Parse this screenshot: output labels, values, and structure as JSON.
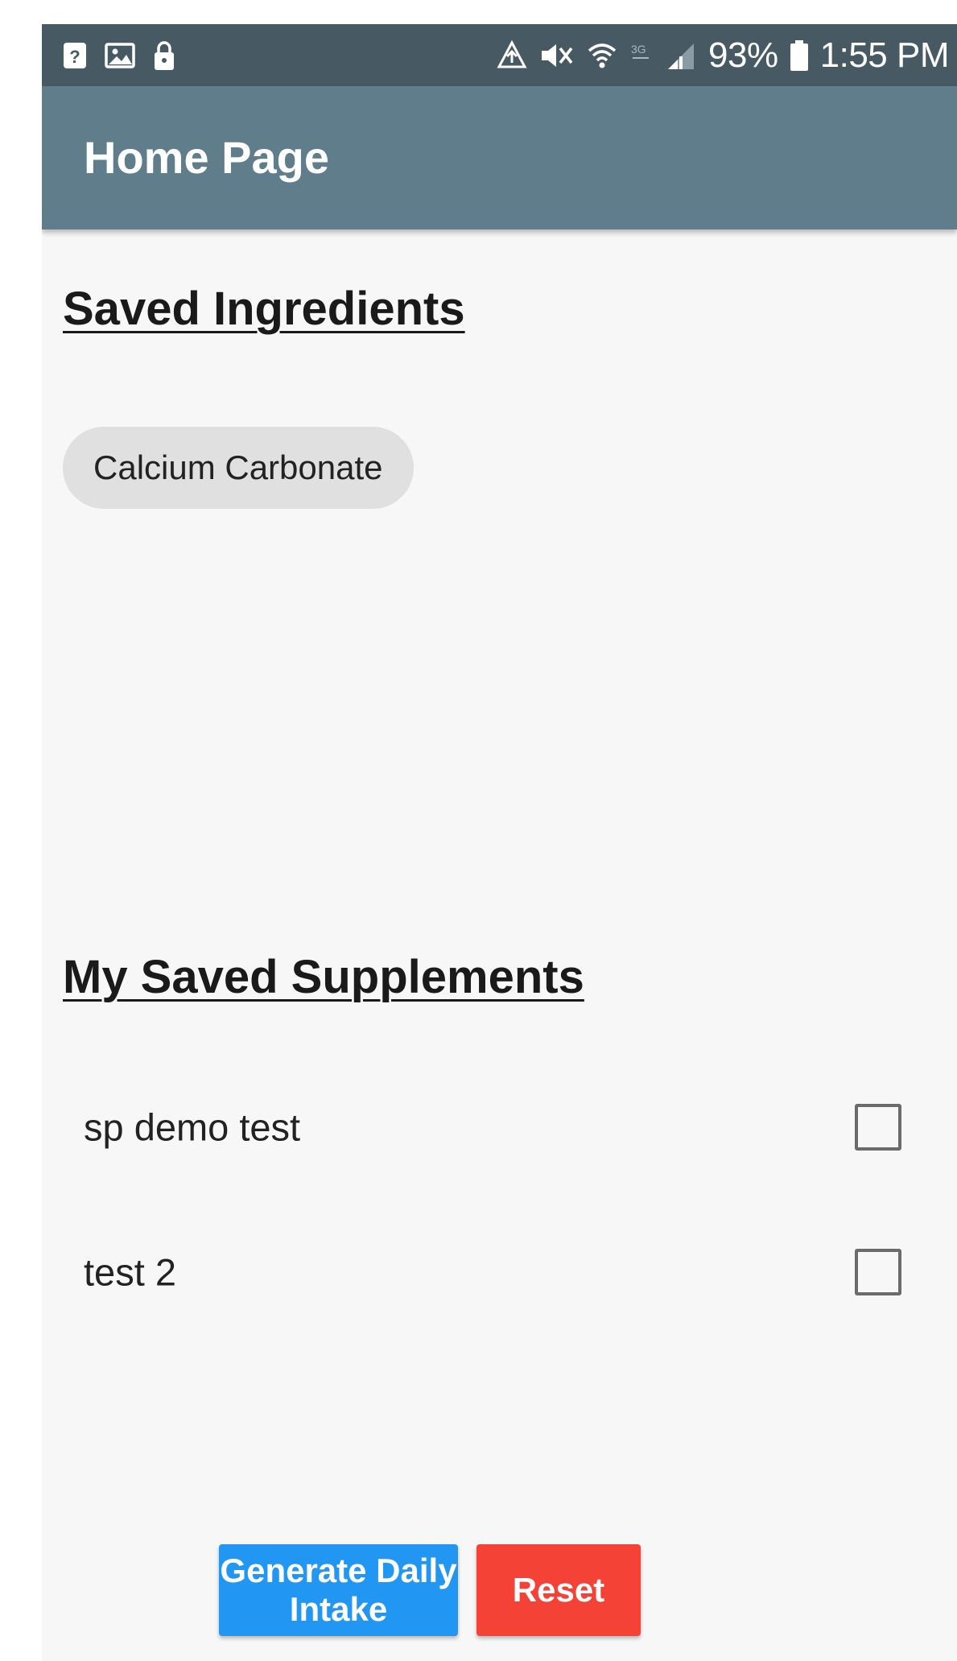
{
  "status_bar": {
    "battery_percent": "93%",
    "time": "1:55 PM",
    "icons_left": [
      "help-box-icon",
      "image-icon",
      "lock-icon"
    ],
    "icons_right": [
      "recycle-upload-icon",
      "mute-icon",
      "wifi-icon",
      "data-off-icon",
      "signal-icon",
      "battery-icon"
    ]
  },
  "app_bar": {
    "title": "Home Page"
  },
  "ingredients": {
    "title": "Saved Ingredients",
    "chips": [
      "Calcium Carbonate"
    ]
  },
  "supplements": {
    "title": "My Saved Supplements",
    "items": [
      {
        "label": "sp demo test",
        "checked": false
      },
      {
        "label": "test 2",
        "checked": false
      }
    ]
  },
  "buttons": {
    "generate_label": "Generate Daily Intake",
    "reset_label": "Reset"
  },
  "colors": {
    "status_bar": "#475a64",
    "app_bar": "#607d8b",
    "primary_button": "#2196f3",
    "reset_button": "#f44336",
    "chip": "#e0e0e0"
  }
}
